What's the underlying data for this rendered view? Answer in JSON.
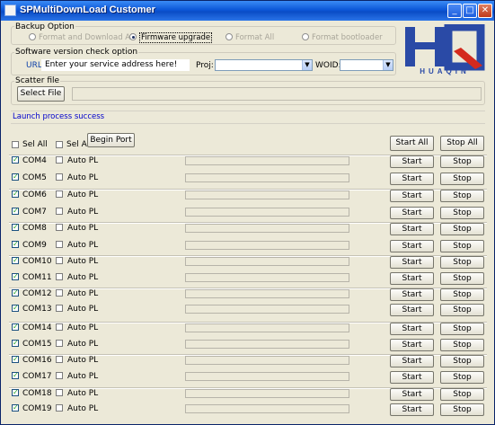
{
  "window": {
    "title": "SPMultiDownLoad Customer",
    "controls": {
      "minimize": "_",
      "maximize": "□",
      "close": "✕"
    }
  },
  "backup": {
    "legend": "Backup Option",
    "options": [
      {
        "label": "Format and Download All",
        "selected": false,
        "enabled": false
      },
      {
        "label": "Firmware upgrade",
        "selected": true,
        "enabled": true
      },
      {
        "label": "Format All",
        "selected": false,
        "enabled": false
      },
      {
        "label": "Format bootloader",
        "selected": false,
        "enabled": false
      }
    ]
  },
  "version_check": {
    "legend": "Software version check option",
    "url_label": "URL:",
    "url_value": "Enter your service address here!",
    "proj_label": "Proj:",
    "proj_value": "",
    "woid_label": "WOID:",
    "woid_value": ""
  },
  "scatter": {
    "legend": "Scatter file",
    "button": "Select File",
    "path": ""
  },
  "status": {
    "text": "Launch process success"
  },
  "header": {
    "sel_all_1": "Sel All",
    "sel_all_2": "Sel All",
    "begin_port": "Begin Port",
    "start_all": "Start All",
    "stop_all": "Stop All"
  },
  "ports": [
    {
      "name": "COM4",
      "checked": true,
      "auto_pl": "Auto PL",
      "progress": 0,
      "start": "Start",
      "stop": "Stop"
    },
    {
      "name": "COM5",
      "checked": true,
      "auto_pl": "Auto PL",
      "progress": 0,
      "start": "Start",
      "stop": "Stop"
    },
    {
      "name": "COM6",
      "checked": true,
      "auto_pl": "Auto PL",
      "progress": 0,
      "start": "Start",
      "stop": "Stop"
    },
    {
      "name": "COM7",
      "checked": true,
      "auto_pl": "Auto PL",
      "progress": 0,
      "start": "Start",
      "stop": "Stop"
    },
    {
      "name": "COM8",
      "checked": true,
      "auto_pl": "Auto PL",
      "progress": 0,
      "start": "Start",
      "stop": "Stop"
    },
    {
      "name": "COM9",
      "checked": true,
      "auto_pl": "Auto PL",
      "progress": 0,
      "start": "Start",
      "stop": "Stop"
    },
    {
      "name": "COM10",
      "checked": true,
      "auto_pl": "Auto PL",
      "progress": 0,
      "start": "Start",
      "stop": "Stop"
    },
    {
      "name": "COM11",
      "checked": true,
      "auto_pl": "Auto PL",
      "progress": 0,
      "start": "Start",
      "stop": "Stop"
    },
    {
      "name": "COM12",
      "checked": true,
      "auto_pl": "Auto PL",
      "progress": 0,
      "start": "Start",
      "stop": "Stop"
    },
    {
      "name": "COM13",
      "checked": true,
      "auto_pl": "Auto PL",
      "progress": 0,
      "start": "Start",
      "stop": "Stop"
    },
    {
      "name": "COM14",
      "checked": true,
      "auto_pl": "Auto PL",
      "progress": 0,
      "start": "Start",
      "stop": "Stop"
    },
    {
      "name": "COM15",
      "checked": true,
      "auto_pl": "Auto PL",
      "progress": 0,
      "start": "Start",
      "stop": "Stop"
    },
    {
      "name": "COM16",
      "checked": true,
      "auto_pl": "Auto PL",
      "progress": 0,
      "start": "Start",
      "stop": "Stop"
    },
    {
      "name": "COM17",
      "checked": true,
      "auto_pl": "Auto PL",
      "progress": 0,
      "start": "Start",
      "stop": "Stop"
    },
    {
      "name": "COM18",
      "checked": true,
      "auto_pl": "Auto PL",
      "progress": 0,
      "start": "Start",
      "stop": "Stop"
    },
    {
      "name": "COM19",
      "checked": true,
      "auto_pl": "Auto PL",
      "progress": 0,
      "start": "Start",
      "stop": "Stop"
    }
  ],
  "logo": {
    "mark": "HQ",
    "text": "HUAQIN"
  },
  "colors": {
    "titlebar": "#0c57d8",
    "status_text": "#0000cc",
    "logo_blue": "#2a4aa6",
    "logo_red": "#d42a1e",
    "checkmark": "#21a121"
  }
}
